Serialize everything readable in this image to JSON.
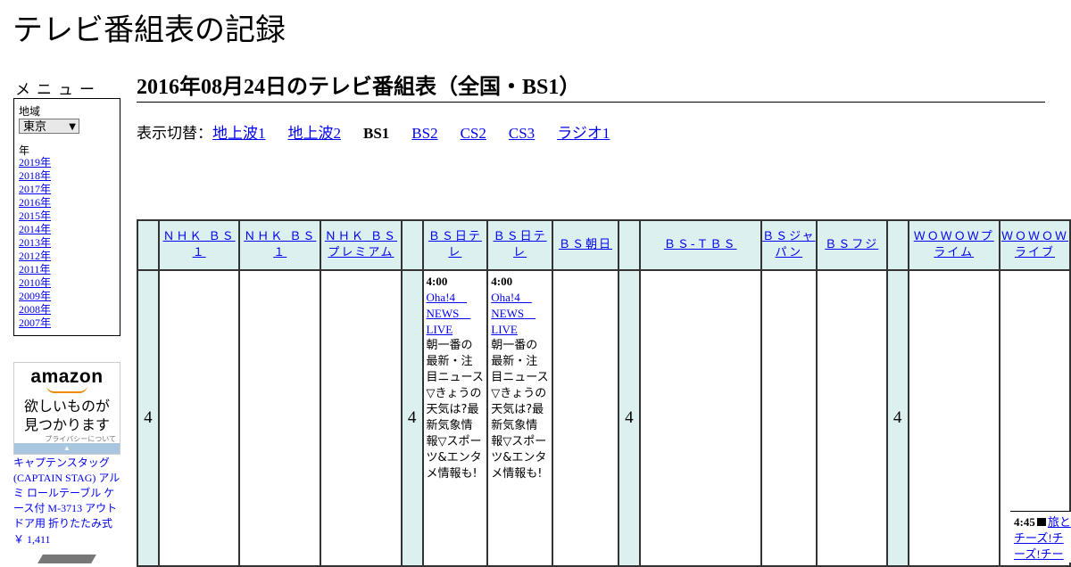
{
  "site": {
    "title": "テレビ番組表の記録"
  },
  "menu": {
    "heading": "メニュー",
    "region_label": "地域",
    "region_value": "東京",
    "year_label": "年",
    "years": [
      "2019年",
      "2018年",
      "2017年",
      "2016年",
      "2015年",
      "2014年",
      "2013年",
      "2012年",
      "2011年",
      "2010年",
      "2009年",
      "2008年",
      "2007年"
    ]
  },
  "ad": {
    "logo": "amazon",
    "text_line1": "欲しいものが",
    "text_line2": "見つかります",
    "privacy": "プライバシーについて",
    "product": "キャプテンスタッグ(CAPTAIN STAG) アルミ ロールテーブル ケース付 M-3713 アウトドア用 折りたたみ式",
    "price": "￥ 1,411"
  },
  "page": {
    "heading": "2016年08月24日のテレビ番組表（全国・BS1）",
    "switch_label": "表示切替：",
    "switch_links": [
      "地上波1",
      "地上波2",
      "BS1",
      "BS2",
      "CS2",
      "CS3",
      "ラジオ1"
    ],
    "switch_current": "BS1"
  },
  "grid": {
    "channels": [
      "ＮＨＫ ＢＳ１",
      "ＮＨＫ ＢＳ１",
      "ＮＨＫ ＢＳプレミアム",
      "ＢＳ日テレ",
      "ＢＳ日テレ",
      "ＢＳ朝日",
      "ＢＳ-ＴＢＳ",
      "ＢＳジャパン",
      "ＢＳフジ",
      "ＷＯＷＯＷプライム",
      "ＷＯＷＯＷライブ"
    ],
    "hour": "4",
    "program": {
      "time": "4:00",
      "title": "Oha!4　NEWS　LIVE",
      "desc": "朝一番の最新・注目ニュース▽きょうの天気は?最新気象情報▽スポーツ&エンタメ情報も!"
    },
    "late_program": {
      "time": "4:45",
      "title": "旅とチーズ!チーズ!チー"
    }
  }
}
